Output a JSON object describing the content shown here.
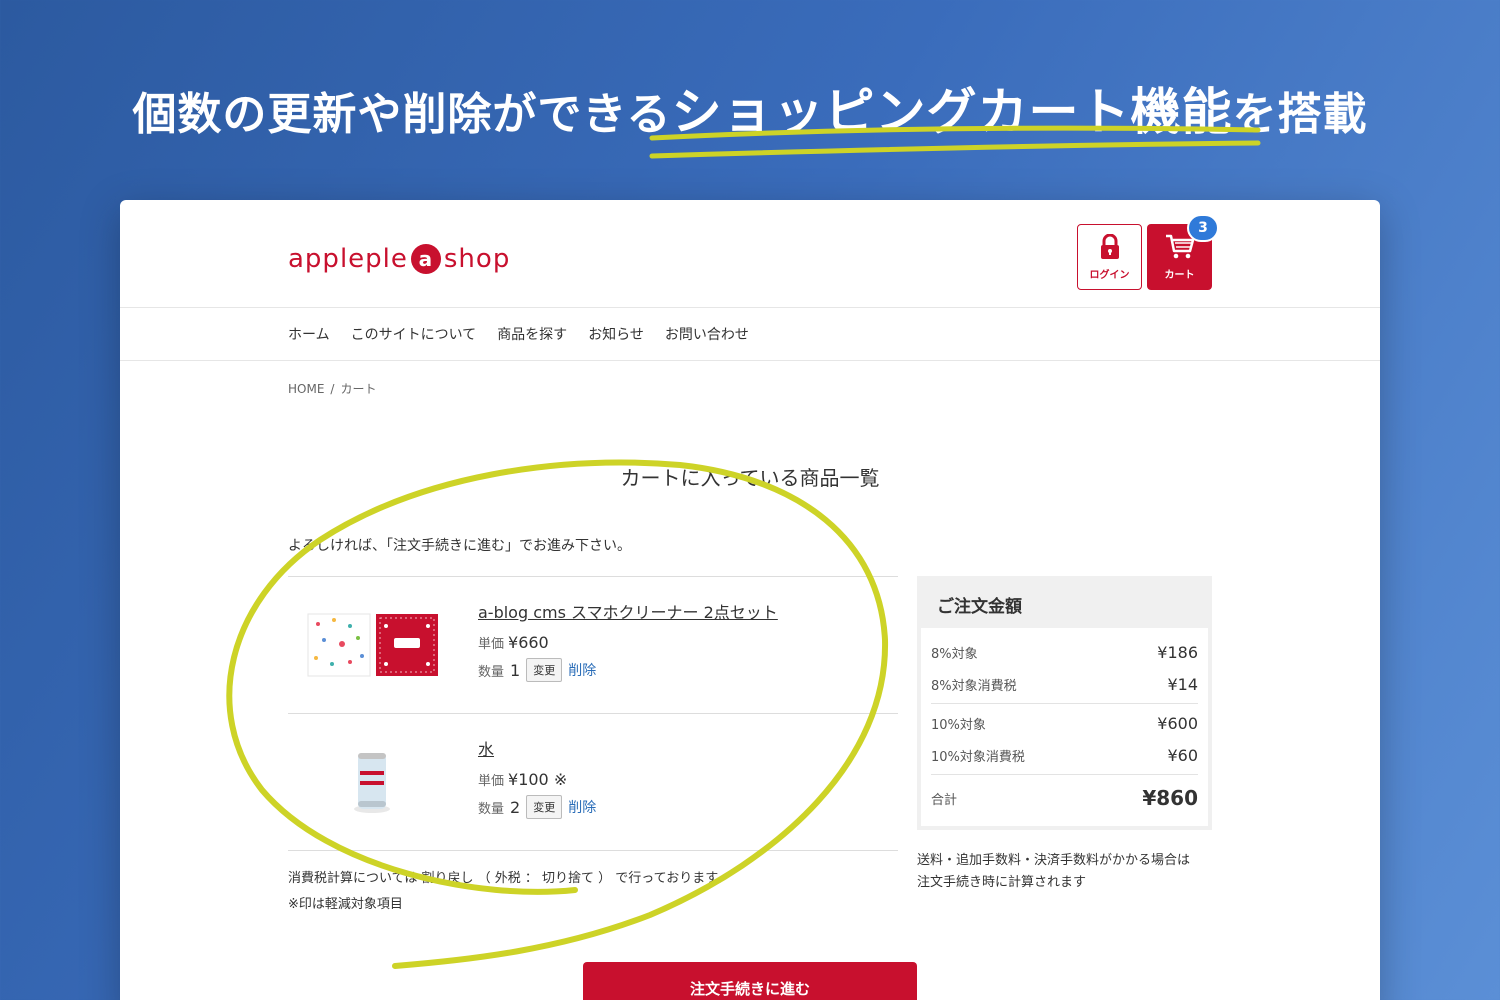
{
  "banner": {
    "headline_pre": "個数の更新や削除ができる",
    "headline_highlight": "ショッピングカート機能",
    "headline_post": "を搭載"
  },
  "site": {
    "logo_pre": "appleple",
    "logo_badge": "a",
    "logo_post": "shop",
    "login_label": "ログイン",
    "cart_label": "カート",
    "cart_count": "3"
  },
  "nav": {
    "items": [
      "ホーム",
      "このサイトについて",
      "商品を探す",
      "お知らせ",
      "お問い合わせ"
    ]
  },
  "breadcrumb": {
    "home": "HOME",
    "sep": "/",
    "current": "カート"
  },
  "page": {
    "title": "カートに入っている商品一覧",
    "intro": "よろしければ、「注文手続きに進む」でお進み下さい。"
  },
  "cart": {
    "unit_price_label": "単価",
    "qty_label": "数量",
    "change_label": "変更",
    "delete_label": "削除",
    "items": [
      {
        "name": "a-blog cms スマホクリーナー 2点セット",
        "price": "¥660",
        "qty": "1"
      },
      {
        "name": "水",
        "price": "¥100 ※",
        "qty": "2"
      }
    ]
  },
  "tax_note": {
    "line1": "消費税計算については 割り戻し （ 外税 ： 切り捨て ） で行っております。",
    "line2": "※印は軽減対象項目"
  },
  "summary": {
    "title": "ご注文金額",
    "rows": [
      {
        "label": "8%対象",
        "amount": "¥186"
      },
      {
        "label": "8%対象消費税",
        "amount": "¥14"
      },
      {
        "label": "10%対象",
        "amount": "¥600"
      },
      {
        "label": "10%対象消費税",
        "amount": "¥60"
      }
    ],
    "total_label": "合計",
    "total_amount": "¥860",
    "shipping_note_line1": "送料・追加手数料・決済手数料がかかる場合は",
    "shipping_note_line2": "注文手続き時に計算されます"
  },
  "checkout": {
    "label": "注文手続きに進む"
  },
  "colors": {
    "brand_red": "#c8102e",
    "badge_blue": "#2f7ad9",
    "annotation_yellow": "#cdd327"
  }
}
